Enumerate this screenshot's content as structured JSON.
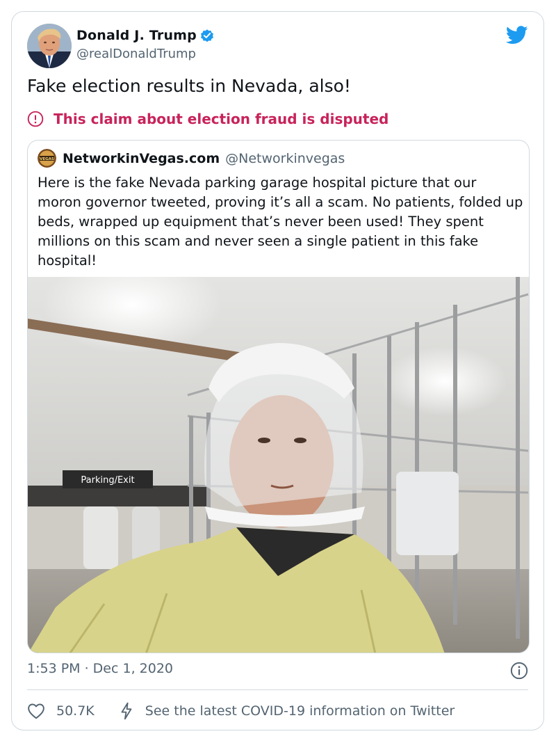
{
  "author": {
    "name": "Donald J. Trump",
    "handle": "@realDonaldTrump"
  },
  "tweet": {
    "text": "Fake election results in Nevada, also!",
    "notice": "This claim about election fraud is disputed"
  },
  "quoted": {
    "name": "NetworkinVegas.com",
    "handle": "@Networkinvegas",
    "text": "Here is the fake Nevada parking garage hospital picture that our moron governor tweeted, proving it’s all a scam. No patients, folded up beds, wrapped up equipment that’s never been used! They spent millions on this scam and never seen a single patient in this fake hospital!",
    "photo_sign": "Parking/Exit"
  },
  "meta": {
    "timestamp": "1:53 PM · Dec 1, 2020"
  },
  "actions": {
    "likes": "50.7K",
    "covid_link": "See the latest COVID-19 information on Twitter"
  },
  "colors": {
    "notice": "#c8235a",
    "muted": "#536471",
    "twitter_blue": "#1d9bf0",
    "border": "#cfd9de"
  },
  "icons": [
    "verified-badge-icon",
    "twitter-bird-icon",
    "exclamation-circle-icon",
    "info-icon",
    "heart-icon",
    "lightning-bolt-icon"
  ]
}
